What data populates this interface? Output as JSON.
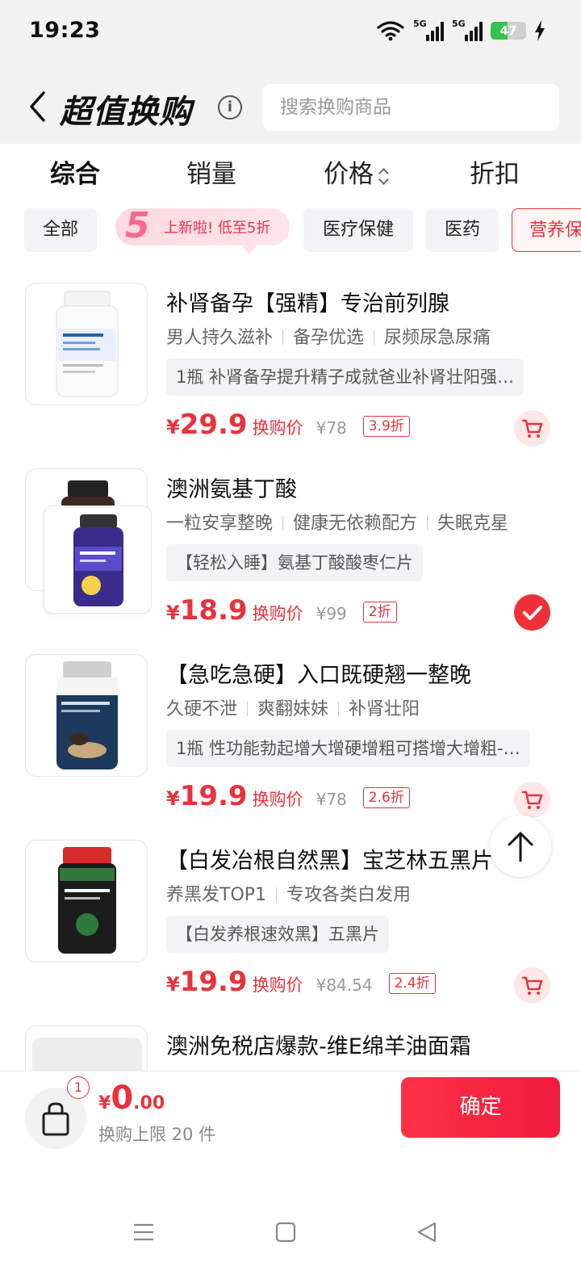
{
  "status": {
    "time": "19:23",
    "network_1": "5G",
    "network_2": "5G",
    "battery": "47",
    "battery_level_pct": 47
  },
  "header": {
    "title": "超值换购",
    "search_placeholder": "搜索换购商品"
  },
  "sort_tabs": [
    "综合",
    "销量",
    "价格",
    "折扣"
  ],
  "chips": {
    "all": "全部",
    "promo_number": "5",
    "promo_text": "上新啦! 低至5折",
    "health": "医疗保健",
    "medicine": "医药",
    "nutrition": "营养保"
  },
  "products": [
    {
      "name": "补肾备孕【强精】专治前列腺",
      "tags": [
        "男人持久滋补",
        "备孕优选",
        "尿频尿急尿痛"
      ],
      "desc": "1瓶 补肾备孕提升精子成就爸业补肾壮阳强…",
      "yen": "¥",
      "price": "29.9",
      "price_label": "换购价",
      "orig": "¥78",
      "discount": "3.9折",
      "selected": false
    },
    {
      "name": "澳洲氨基丁酸",
      "tags": [
        "一粒安享整晚",
        "健康无依赖配方",
        "失眠克星"
      ],
      "desc": "【轻松入睡】氨基丁酸酸枣仁片",
      "yen": "¥",
      "price": "18.9",
      "price_label": "换购价",
      "orig": "¥99",
      "discount": "2折",
      "selected": true
    },
    {
      "name": "【急吃急硬】入口既硬翘一整晚",
      "tags": [
        "久硬不泄",
        "爽翻妹妹",
        "补肾壮阳"
      ],
      "desc": "1瓶 性功能勃起增大增硬增粗可搭增大增粗-…",
      "yen": "¥",
      "price": "19.9",
      "price_label": "换购价",
      "orig": "¥78",
      "discount": "2.6折",
      "selected": false
    },
    {
      "name": "【白发冶根自然黑】宝芝林五黑片",
      "tags": [
        "养黑发TOP1",
        "专攻各类白发用"
      ],
      "desc": "【白发养根速效黑】五黑片",
      "yen": "¥",
      "price": "19.9",
      "price_label": "换购价",
      "orig": "¥84.54",
      "discount": "2.4折",
      "selected": false
    },
    {
      "name": "澳洲免税店爆款-维E绵羊油面霜"
    }
  ],
  "bottom": {
    "badge": "1",
    "yen": "¥",
    "total_int": "0",
    "total_dec": ".00",
    "limit": "换购上限 20 件",
    "confirm": "确定"
  },
  "colors": {
    "accent": "#e8323c",
    "confirm": "#f21c3c",
    "battery": "#35c24f"
  }
}
